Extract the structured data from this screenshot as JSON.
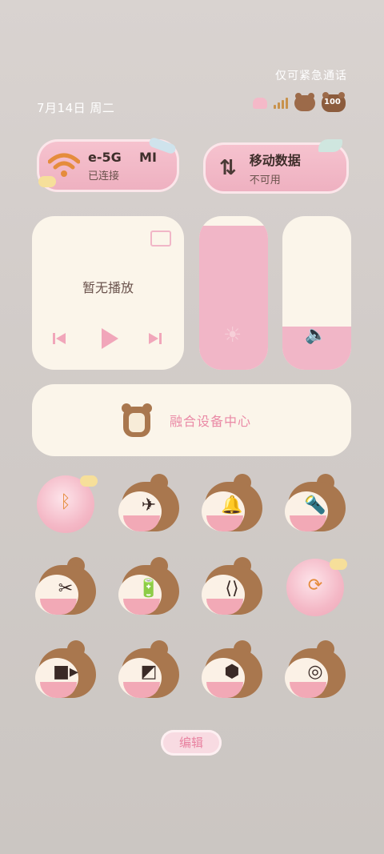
{
  "status": {
    "right_text": "仅可紧急通话",
    "date": "7月14日 周二",
    "battery": "100"
  },
  "tiles": {
    "wifi": {
      "title": "e-5G    MI",
      "subtitle": "已连接"
    },
    "data": {
      "title": "移动数据",
      "subtitle": "不可用"
    }
  },
  "media": {
    "text": "暂无播放"
  },
  "sliders": {
    "brightness_level": 0.94,
    "volume_level": 0.28
  },
  "fusion": {
    "label": "融合设备中心"
  },
  "toggles": [
    {
      "name": "bluetooth",
      "icon": "bluetooth-icon",
      "style": "peach",
      "glyph": "ᛒ"
    },
    {
      "name": "airplane",
      "icon": "airplane-icon",
      "style": "bear",
      "glyph": "✈"
    },
    {
      "name": "bell",
      "icon": "bell-icon",
      "style": "bear",
      "glyph": "🔔"
    },
    {
      "name": "flashlight",
      "icon": "flashlight-icon",
      "style": "bear",
      "glyph": "🔦"
    },
    {
      "name": "screenshot",
      "icon": "scissors-icon",
      "style": "bear",
      "glyph": "✂"
    },
    {
      "name": "battery",
      "icon": "battery-saver-icon",
      "style": "bear",
      "glyph": "🔋"
    },
    {
      "name": "share",
      "icon": "share-icon",
      "style": "bear",
      "glyph": "⟨⟩"
    },
    {
      "name": "rotation",
      "icon": "rotation-lock-icon",
      "style": "peach",
      "glyph": "⟳"
    },
    {
      "name": "screen-record",
      "icon": "video-camera-icon",
      "style": "bear",
      "glyph": "■▸"
    },
    {
      "name": "projection",
      "icon": "projection-icon",
      "style": "bear",
      "glyph": "◩"
    },
    {
      "name": "nfc",
      "icon": "hexagon-icon",
      "style": "bear",
      "glyph": "⬢"
    },
    {
      "name": "eye-comfort",
      "icon": "eye-comfort-icon",
      "style": "bear",
      "glyph": "◎"
    }
  ],
  "edit": {
    "label": "编辑"
  },
  "colors": {
    "pink": "#f1b6c7",
    "cream": "#fbf5ea",
    "bear": "#a9774e",
    "accent": "#ea8aa6",
    "orange": "#e58c3c"
  }
}
